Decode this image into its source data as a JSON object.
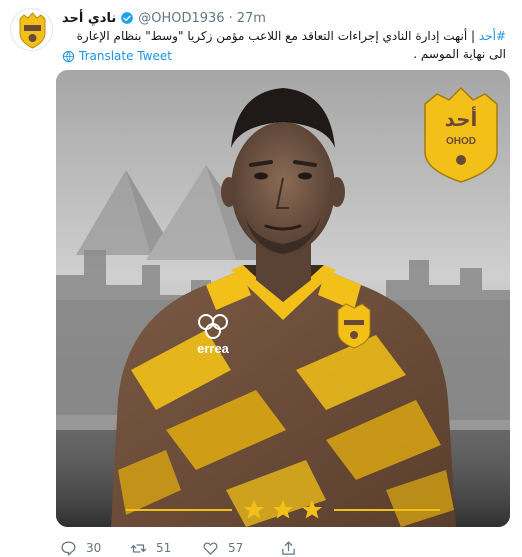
{
  "tweet": {
    "display_name": "نادي أحد",
    "handle": "@OHOD1936",
    "separator": "·",
    "time": "27m",
    "hashtag": "#أحد",
    "text_separator": " | ",
    "text": "أنهت إدارة النادي إجراءات التعاقد مع اللاعب مؤمن زكريا \"وسط\" بنظام الإعارة الى نهاية الموسم .",
    "translate_label": "Translate Tweet"
  },
  "logo": {
    "top_text": "أحد",
    "bottom_text": "OHOD"
  },
  "jersey": {
    "brand": "errea"
  },
  "actions": {
    "replies": "30",
    "retweets": "51",
    "likes": "57"
  },
  "colors": {
    "accent_blue": "#1b95e0",
    "club_yellow": "#f2c018",
    "club_brown": "#6a4a36",
    "muted_gray": "#657786"
  },
  "icons": {
    "verified": "verified-badge-icon",
    "translate": "globe-icon",
    "reply": "reply-icon",
    "retweet": "retweet-icon",
    "like": "heart-icon",
    "share": "share-icon",
    "stars": "star-icon"
  }
}
